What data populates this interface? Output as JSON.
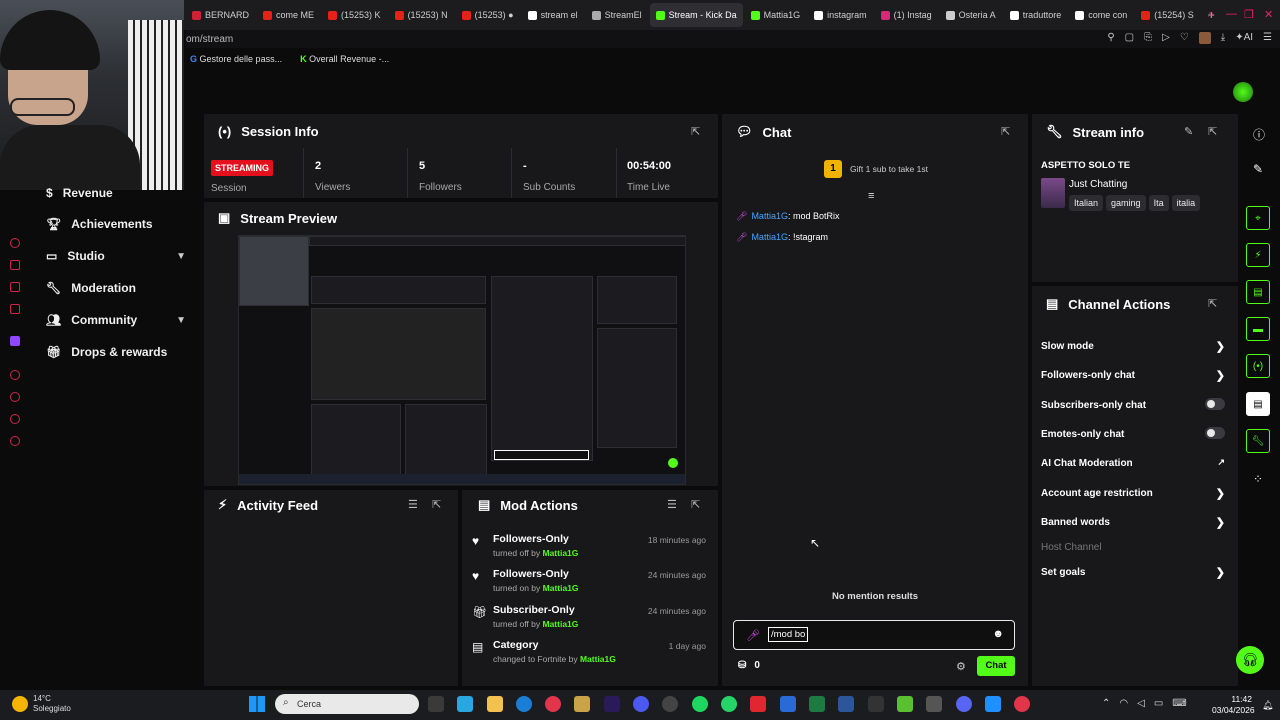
{
  "browser": {
    "tabs": [
      {
        "label": "BERNARD",
        "color": "#cc2233"
      },
      {
        "label": "come ME",
        "color": "#e62117"
      },
      {
        "label": "(15253) K",
        "color": "#e62117"
      },
      {
        "label": "(15253) N",
        "color": "#e62117"
      },
      {
        "label": "(15253) ●",
        "color": "#e62117"
      },
      {
        "label": "stream el",
        "color": "#ffffff"
      },
      {
        "label": "StreamEl",
        "color": "#aaaaaa"
      },
      {
        "label": "Stream - Kick Da",
        "color": "#53fc18",
        "active": true
      },
      {
        "label": "Mattia1G",
        "color": "#53fc18"
      },
      {
        "label": "instagram",
        "color": "#ffffff"
      },
      {
        "label": "(1) Instag",
        "color": "#d62976"
      },
      {
        "label": "Osteria A",
        "color": "#cccccc"
      },
      {
        "label": "traduttore",
        "color": "#ffffff"
      },
      {
        "label": "come con",
        "color": "#ffffff"
      },
      {
        "label": "(15254) S",
        "color": "#e62117"
      }
    ],
    "url": "om/stream",
    "bookmarks": [
      "Gestore delle pass...",
      "Overall Revenue -..."
    ]
  },
  "sidebar": {
    "items": [
      {
        "label": "Revenue",
        "icon": "dollar-icon"
      },
      {
        "label": "Achievements",
        "icon": "trophy-icon"
      },
      {
        "label": "Studio",
        "icon": "monitor-icon",
        "chevron": true
      },
      {
        "label": "Moderation",
        "icon": "wrench-icon"
      },
      {
        "label": "Community",
        "icon": "people-icon",
        "chevron": true
      },
      {
        "label": "Drops & rewards",
        "icon": "gift-icon"
      }
    ]
  },
  "session_info": {
    "title": "Session Info",
    "stats": [
      {
        "value": "STREAMING",
        "label": "Session"
      },
      {
        "value": "2",
        "label": "Viewers"
      },
      {
        "value": "5",
        "label": "Followers"
      },
      {
        "value": "-",
        "label": "Sub Counts"
      },
      {
        "value": "00:54:00",
        "label": "Time Live"
      }
    ]
  },
  "stream_preview": {
    "title": "Stream Preview"
  },
  "activity_feed": {
    "title": "Activity Feed"
  },
  "mod_actions": {
    "title": "Mod Actions",
    "items": [
      {
        "title": "Followers-Only",
        "action": "turned off by",
        "user": "Mattia1G",
        "ago": "18 minutes ago",
        "icon": "heart-icon"
      },
      {
        "title": "Followers-Only",
        "action": "turned on by",
        "user": "Mattia1G",
        "ago": "24 minutes ago",
        "icon": "heart-icon"
      },
      {
        "title": "Subscriber-Only",
        "action": "turned off by",
        "user": "Mattia1G",
        "ago": "24 minutes ago",
        "icon": "gift-icon"
      },
      {
        "title": "Category",
        "action": "changed to Fortnite by",
        "user": "Mattia1G",
        "ago": "1 day ago",
        "icon": "category-icon"
      }
    ]
  },
  "chat": {
    "title": "Chat",
    "gift_banner": "Gift 1 sub to take 1st",
    "gift_count": "1",
    "messages": [
      {
        "user": "Mattia1G",
        "text": ": mod BotRix"
      },
      {
        "user": "Mattia1G",
        "text": ": !stagram"
      }
    ],
    "mention_status": "No mention results",
    "input_value": "/mod bo",
    "points": "0",
    "send_label": "Chat"
  },
  "stream_info": {
    "title": "Stream info",
    "stream_title": "ASPETTO SOLO TE",
    "category": "Just Chatting",
    "tags": [
      "Italian",
      "gaming",
      "Ita",
      "italia"
    ]
  },
  "channel_actions": {
    "title": "Channel Actions",
    "items": [
      {
        "label": "Slow mode",
        "control": "chevron"
      },
      {
        "label": "Followers-only chat",
        "control": "chevron"
      },
      {
        "label": "Subscribers-only chat",
        "control": "toggle",
        "on": false
      },
      {
        "label": "Emotes-only chat",
        "control": "toggle",
        "on": false
      },
      {
        "label": "AI Chat Moderation",
        "control": "external"
      },
      {
        "label": "Account age restriction",
        "control": "chevron"
      },
      {
        "label": "Banned words",
        "control": "chevron"
      },
      {
        "label": "Host Channel",
        "control": "none",
        "disabled": true
      },
      {
        "label": "Set goals",
        "control": "chevron"
      }
    ]
  },
  "taskbar": {
    "weather_temp": "14°C",
    "weather_text": "Soleggiato",
    "search_placeholder": "Cerca",
    "time": "11:42",
    "date": "03/04/2026"
  },
  "colors": {
    "accent": "#53fc18",
    "live": "#e5101e",
    "panel": "#18181b",
    "bg": "#0b0b0c"
  }
}
